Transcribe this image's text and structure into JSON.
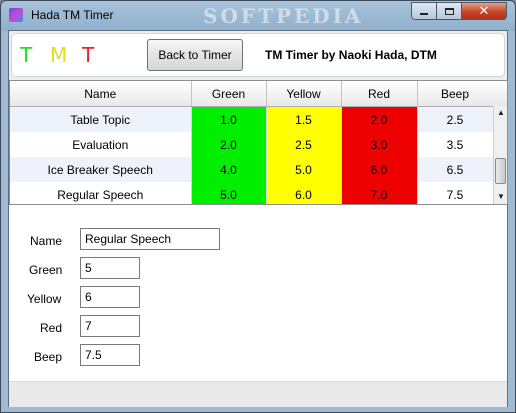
{
  "window": {
    "title": "Hada TM Timer",
    "watermark": "SOFTPEDIA"
  },
  "header": {
    "logo": {
      "t1": "T",
      "m": "M",
      "t2": "T"
    },
    "back_label": "Back to Timer",
    "byline": "TM Timer by Naoki Hada, DTM"
  },
  "colors": {
    "green": "#00ee00",
    "yellow": "#ffff00",
    "red": "#ee0000"
  },
  "table": {
    "columns": [
      "Name",
      "Green",
      "Yellow",
      "Red",
      "Beep"
    ],
    "rows": [
      [
        "Table Topic",
        "1.0",
        "1.5",
        "2.0",
        "2.5"
      ],
      [
        "Evaluation",
        "2.0",
        "2.5",
        "3.0",
        "3.5"
      ],
      [
        "Ice Breaker Speech",
        "4.0",
        "5.0",
        "6.0",
        "6.5"
      ],
      [
        "Regular Speech",
        "5.0",
        "6.0",
        "7.0",
        "7.5"
      ]
    ]
  },
  "form": {
    "name_label": "Name",
    "name_value": "Regular Speech",
    "green_label": "Green",
    "green_value": "5",
    "yellow_label": "Yellow",
    "yellow_value": "6",
    "red_label": "Red",
    "red_value": "7",
    "beep_label": "Beep",
    "beep_value": "7.5"
  }
}
